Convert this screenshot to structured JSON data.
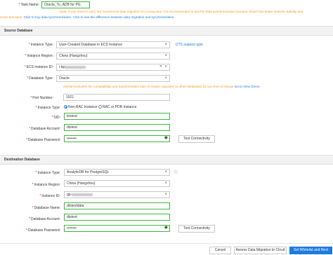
{
  "task": {
    "label": "Task Name:",
    "value": "Oracle_To_ADB for PG",
    "notice_line1": "Note: If you need to carry out incremental data migration for a long time, it is recommended to use the data synchronization function, which has better network stability and",
    "notice_line2_prefix": "richer functions.",
    "notice_link1": "Click to buy data synchronization.",
    "notice_link2": "Click to see the difference between data migration and synchronization."
  },
  "source": {
    "title": "Source Database",
    "instance_type_label": "Instance Type:",
    "instance_type_value": "User-Created Database in ECS Instance",
    "dts_link": "DTS support type",
    "instance_region_label": "Instance Region:",
    "instance_region_value": "China (Hangzhou)",
    "ecs_id_label": "ECS Instance ID:",
    "ecs_id_value": "i-bp",
    "db_type_label": "Database Type:",
    "db_type_value": "Oracle",
    "adam_text": "ADAM evaluates the compatibility and transformation plan of Oracle migration to other databases for you free of charge",
    "goto_link": "Go to",
    "demo_link": "View Demo",
    "port_label": "Port Number:",
    "port_value": "1521",
    "inst_type2_label": "Instance Type:",
    "non_rac": "Non-RAC Instance",
    "rac": "RAC or PDB Instance",
    "sid_label": "SID:",
    "sid_value": "testest",
    "account_label": "Database Account:",
    "account_value": "dtstest",
    "password_label": "Database Password:",
    "password_value": "••••••••",
    "test_button": "Test Connectivity"
  },
  "destination": {
    "title": "Destination Database",
    "instance_type_label": "Instance Type:",
    "instance_type_value": "AnalyticDB for PostgreSQL",
    "instance_region_label": "Instance Region:",
    "instance_region_value": "China (Hangzhou)",
    "instance_id_label": "Instance ID:",
    "instance_id_value": "gp-",
    "db_name_label": "Database Name:",
    "db_name_value": "dtstestdata",
    "account_label": "Database Account:",
    "account_value": "dtstest",
    "password_label": "Database Password:",
    "password_value": "••••••••",
    "test_button": "Test Connectivity"
  },
  "footer": {
    "cancel": "Cancel",
    "assess": "Assess Data Migration to Cloud",
    "next": "Set Whitelist and Next"
  }
}
